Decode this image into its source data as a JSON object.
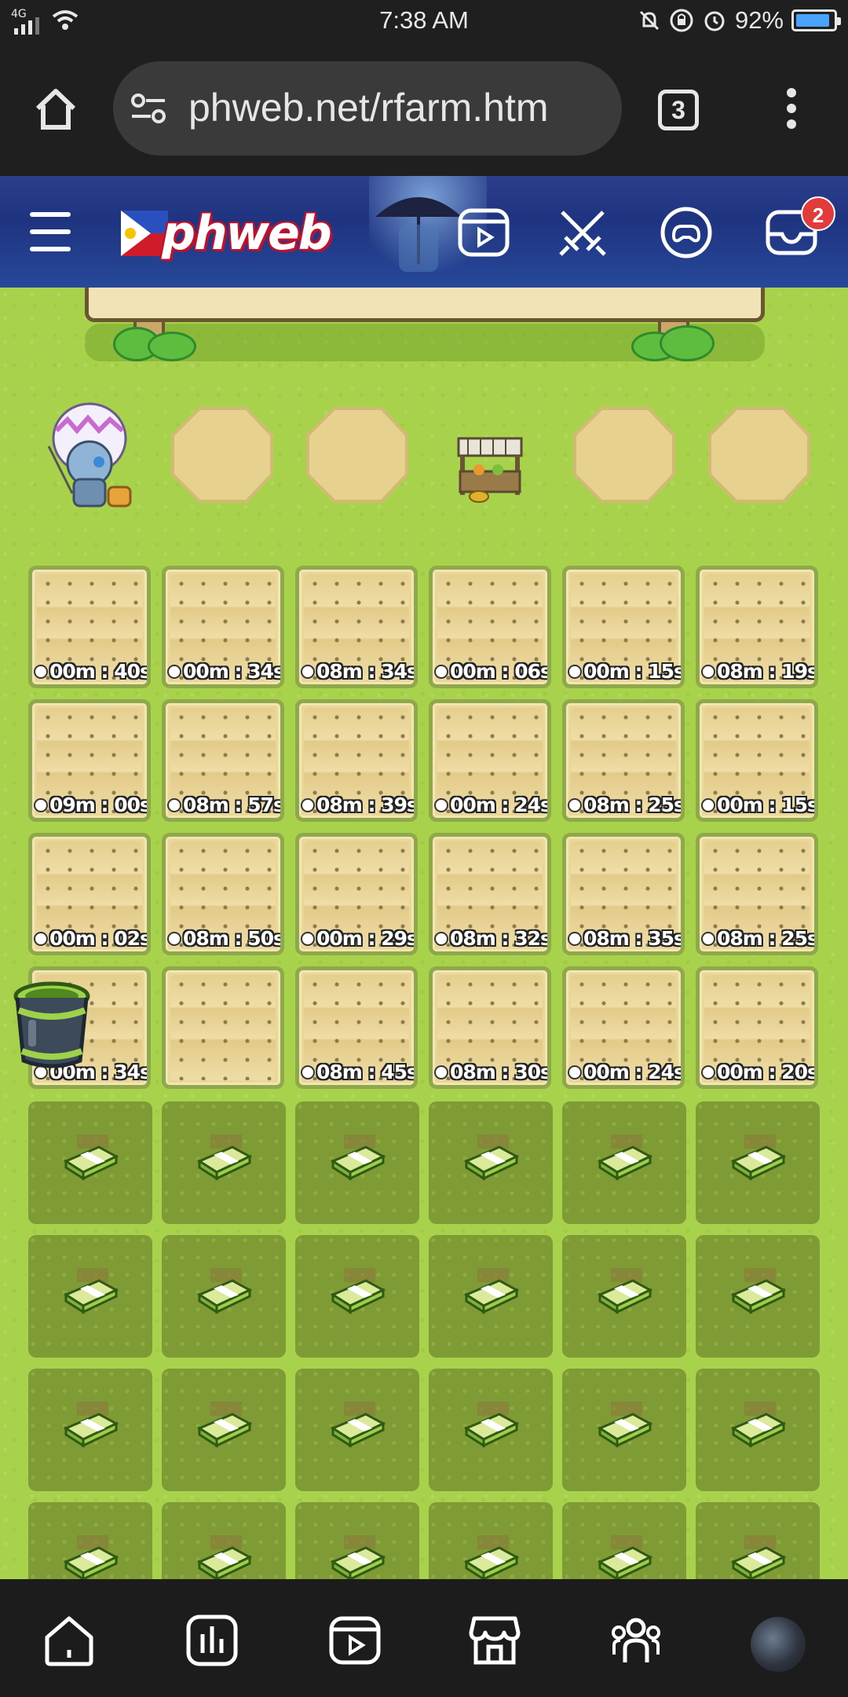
{
  "status_bar": {
    "network": "4G",
    "time": "7:38 AM",
    "battery": "92%",
    "battery_level": 0.92
  },
  "browser": {
    "url": "phweb.net/rfarm.htm",
    "tab_count": "3"
  },
  "site_header": {
    "logo_text": "phweb",
    "notification_count": "2"
  },
  "farm": {
    "plots": [
      [
        "00m : 40s",
        "00m : 34s",
        "08m : 34s",
        "00m : 06s",
        "00m : 15s",
        "08m : 19s"
      ],
      [
        "09m : 00s",
        "08m : 57s",
        "08m : 39s",
        "00m : 24s",
        "08m : 25s",
        "00m : 15s"
      ],
      [
        "00m : 02s",
        "08m : 50s",
        "00m : 29s",
        "08m : 32s",
        "08m : 35s",
        "08m : 25s"
      ],
      [
        "00m : 34s",
        "",
        "08m : 45s",
        "08m : 30s",
        "00m : 24s",
        "00m : 20s"
      ]
    ],
    "locked_rows": 4,
    "locked_cols": 6
  },
  "colors": {
    "grass": "#a9d24c",
    "header_blue": "#1f3480",
    "badge_red": "#e23b3b",
    "battery_blue": "#4aa3ff"
  }
}
